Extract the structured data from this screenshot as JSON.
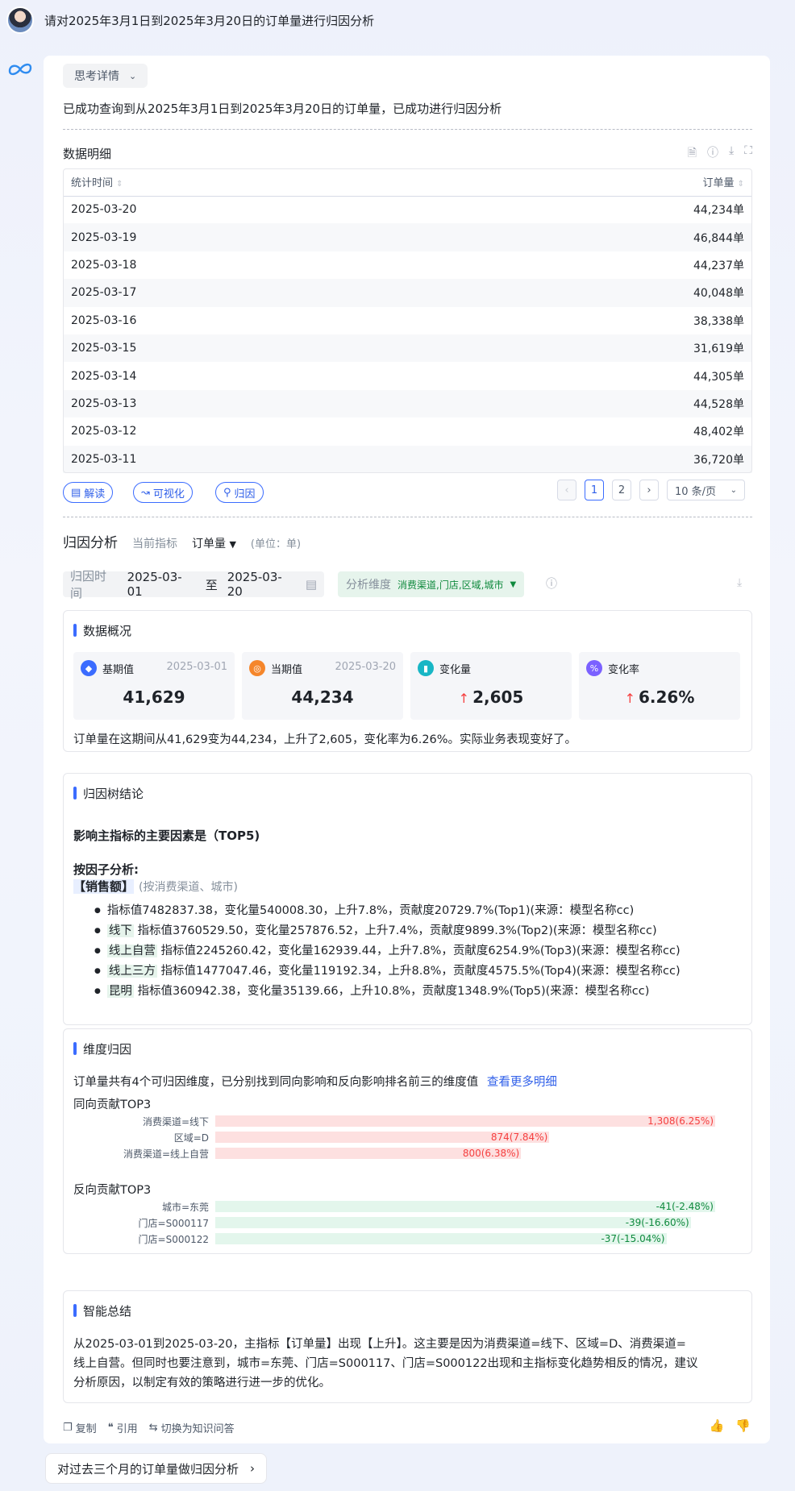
{
  "question": "请对2025年3月1日到2025年3月20日的订单量进行归因分析",
  "answer": {
    "think_label": "思考详情",
    "summary": "已成功查询到从2025年3月1日到2025年3月20日的订单量，已成功进行归因分析"
  },
  "detail": {
    "title": "数据明细",
    "col_time": "统计时间",
    "col_orders": "订单量",
    "rows": [
      {
        "date": "2025-03-20",
        "value": "44,234单"
      },
      {
        "date": "2025-03-19",
        "value": "46,844单"
      },
      {
        "date": "2025-03-18",
        "value": "44,237单"
      },
      {
        "date": "2025-03-17",
        "value": "40,048单"
      },
      {
        "date": "2025-03-16",
        "value": "38,338单"
      },
      {
        "date": "2025-03-15",
        "value": "31,619单"
      },
      {
        "date": "2025-03-14",
        "value": "44,305单"
      },
      {
        "date": "2025-03-13",
        "value": "44,528单"
      },
      {
        "date": "2025-03-12",
        "value": "48,402单"
      },
      {
        "date": "2025-03-11",
        "value": "36,720单"
      }
    ],
    "actions": {
      "interpret": "解读",
      "visualize": "可视化",
      "attribute": "归因"
    },
    "pager": {
      "page1": "1",
      "page2": "2",
      "page_size": "10 条/页"
    }
  },
  "attribution": {
    "title": "归因分析",
    "metric_label": "当前指标",
    "metric": "订单量",
    "unit": "(单位：单)",
    "time_label": "归因时间",
    "start": "2025-03-01",
    "to": "至",
    "end": "2025-03-20",
    "dim_label": "分析维度",
    "dims": "消费渠道,门店,区域,城市"
  },
  "overview": {
    "title": "数据概况",
    "kpis": [
      {
        "name": "基期值",
        "date": "2025-03-01",
        "value": "41,629",
        "color": "#3b6cff"
      },
      {
        "name": "当期值",
        "date": "2025-03-20",
        "value": "44,234",
        "color": "#f5862b"
      },
      {
        "name": "变化量",
        "date": "",
        "value": "2,605",
        "color": "#18b6c5"
      },
      {
        "name": "变化率",
        "date": "",
        "value": "6.26%",
        "color": "#7b61ff"
      }
    ],
    "text": "订单量在这期间从41,629变为44,234，上升了2,605，变化率为6.26%。实际业务表现变好了。"
  },
  "tree": {
    "title": "归因树结论",
    "heading": "影响主指标的主要因素是（TOP5)",
    "by_factor": "按因子分析:",
    "factor": "【销售额】",
    "factor_dims": "(按消费渠道、城市)",
    "items": [
      {
        "tag": "",
        "text": "指标值7482837.38，变化量540008.30，上升7.8%，贡献度20729.7%(Top1)(来源：模型名称cc)"
      },
      {
        "tag": "线下",
        "text": " 指标值3760529.50，变化量257876.52，上升7.4%，贡献度9899.3%(Top2)(来源：模型名称cc)"
      },
      {
        "tag": "线上自营",
        "text": " 指标值2245260.42，变化量162939.44，上升7.8%，贡献度6254.9%(Top3)(来源：模型名称cc)"
      },
      {
        "tag": "线上三方",
        "text": " 指标值1477047.46，变化量119192.34，上升8.8%，贡献度4575.5%(Top4)(来源：模型名称cc)"
      },
      {
        "tag": "昆明",
        "text": " 指标值360942.38，变化量35139.66，上升10.8%，贡献度1348.9%(Top5)(来源：模型名称cc)"
      }
    ]
  },
  "dimension": {
    "title": "维度归因",
    "desc": "订单量共有4个可归因维度，已分别找到同向影响和反向影响排名前三的维度值",
    "more_link": "查看更多明细",
    "pos_title": "同向贡献TOP3",
    "neg_title": "反向贡献TOP3",
    "positive": [
      {
        "label": "消费渠道=线下",
        "text": "1,308(6.25%)",
        "value": 1308
      },
      {
        "label": "区域=D",
        "text": "874(7.84%)",
        "value": 874
      },
      {
        "label": "消费渠道=线上自营",
        "text": "800(6.38%)",
        "value": 800
      }
    ],
    "negative": [
      {
        "label": "城市=东莞",
        "text": "-41(-2.48%)",
        "value": -41
      },
      {
        "label": "门店=S000117",
        "text": "-39(-16.60%)",
        "value": -39
      },
      {
        "label": "门店=S000122",
        "text": "-37(-15.04%)",
        "value": -37
      }
    ],
    "colors": {
      "pos_bar": "#fde0e0",
      "pos_text": "#f53f3f",
      "neg_bar": "#e3f6ec",
      "neg_text": "#108a3e"
    }
  },
  "smart": {
    "title": "智能总结",
    "line1": "从2025-03-01到2025-03-20，主指标【订单量】出现【上升】。这主要是因为消费渠道=线下、区域=D、消费渠道=",
    "line2": "线上自营。但同时也要注意到，城市=东莞、门店=S000117、门店=S000122出现和主指标变化趋势相反的情况，建议",
    "line3": "分析原因，以制定有效的策略进行进一步的优化。"
  },
  "footer": {
    "copy": "复制",
    "quote": "引用",
    "switch": "切换为知识问答"
  },
  "suggestion": "对过去三个月的订单量做归因分析"
}
